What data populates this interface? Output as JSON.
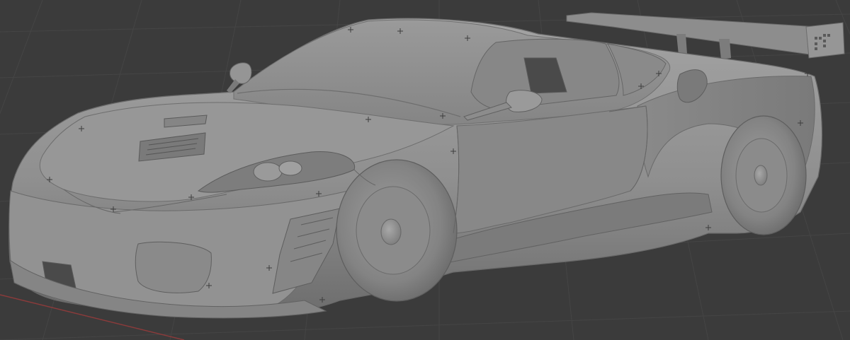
{
  "viewport": {
    "kind": "3d-viewport",
    "shading": "solid",
    "grid_visible": true,
    "x_axis_visible": true,
    "background_color": "#3b3b3b",
    "grid_color": "#454545",
    "x_axis_color": "#8a3b3b",
    "model_color": "#8f8f8f"
  },
  "model": {
    "object": "race-car-body",
    "wing_emblem_glyph": "▪"
  }
}
